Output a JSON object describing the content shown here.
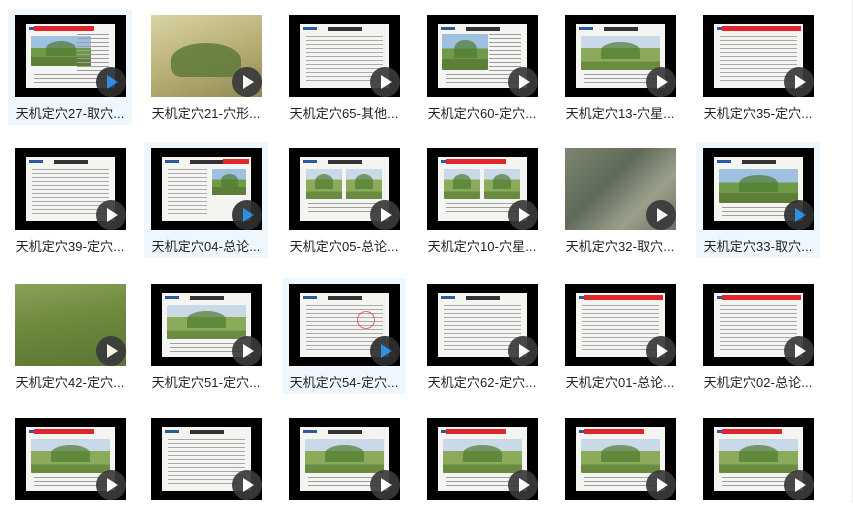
{
  "files": [
    {
      "label": "天机定穴27-取穴...",
      "style": "doc-hill",
      "hl": true,
      "blue": true
    },
    {
      "label": "天机定穴21-穴形...",
      "style": "photo",
      "hl": false,
      "blue": false
    },
    {
      "label": "天机定穴65-其他...",
      "style": "text",
      "hl": false,
      "blue": false
    },
    {
      "label": "天机定穴60-定穴...",
      "style": "hill-side",
      "hl": false,
      "blue": false
    },
    {
      "label": "天机定穴13-穴星...",
      "style": "hill",
      "hl": false,
      "blue": false
    },
    {
      "label": "天机定穴35-定穴...",
      "style": "doc-red",
      "hl": false,
      "blue": false
    },
    {
      "label": "天机定穴39-定穴...",
      "style": "text",
      "hl": false,
      "blue": false
    },
    {
      "label": "天机定穴04-总论...",
      "style": "text-side",
      "hl": true,
      "blue": true
    },
    {
      "label": "天机定穴05-总论...",
      "style": "two",
      "hl": false,
      "blue": false
    },
    {
      "label": "天机定穴10-穴星...",
      "style": "two-red",
      "hl": false,
      "blue": false
    },
    {
      "label": "天机定穴32-取穴...",
      "style": "aerial",
      "hl": false,
      "blue": false
    },
    {
      "label": "天机定穴33-取穴...",
      "style": "hill-wide",
      "hl": true,
      "blue": true
    },
    {
      "label": "天机定穴42-定穴...",
      "style": "field",
      "hl": false,
      "blue": false
    },
    {
      "label": "天机定穴51-定穴...",
      "style": "hill",
      "hl": false,
      "blue": false
    },
    {
      "label": "天机定穴54-定穴...",
      "style": "text-stamp",
      "hl": true,
      "blue": true
    },
    {
      "label": "天机定穴62-定穴...",
      "style": "text",
      "hl": false,
      "blue": false
    },
    {
      "label": "天机定穴01-总论...",
      "style": "text-red",
      "hl": false,
      "blue": false
    },
    {
      "label": "天机定穴02-总论...",
      "style": "text-red",
      "hl": false,
      "blue": false
    },
    {
      "label": "",
      "style": "hill-red",
      "hl": false,
      "blue": false
    },
    {
      "label": "",
      "style": "text",
      "hl": false,
      "blue": false
    },
    {
      "label": "",
      "style": "hill",
      "hl": false,
      "blue": false
    },
    {
      "label": "",
      "style": "hill-red",
      "hl": false,
      "blue": false
    },
    {
      "label": "",
      "style": "hill-red",
      "hl": false,
      "blue": false
    },
    {
      "label": "",
      "style": "hill-red",
      "hl": false,
      "blue": false
    }
  ],
  "colors": {
    "highlight": "#eef6fe",
    "thumb_bg": "#000000",
    "play_accent": "#1e88e5"
  },
  "icons": {
    "play": "play-icon"
  }
}
